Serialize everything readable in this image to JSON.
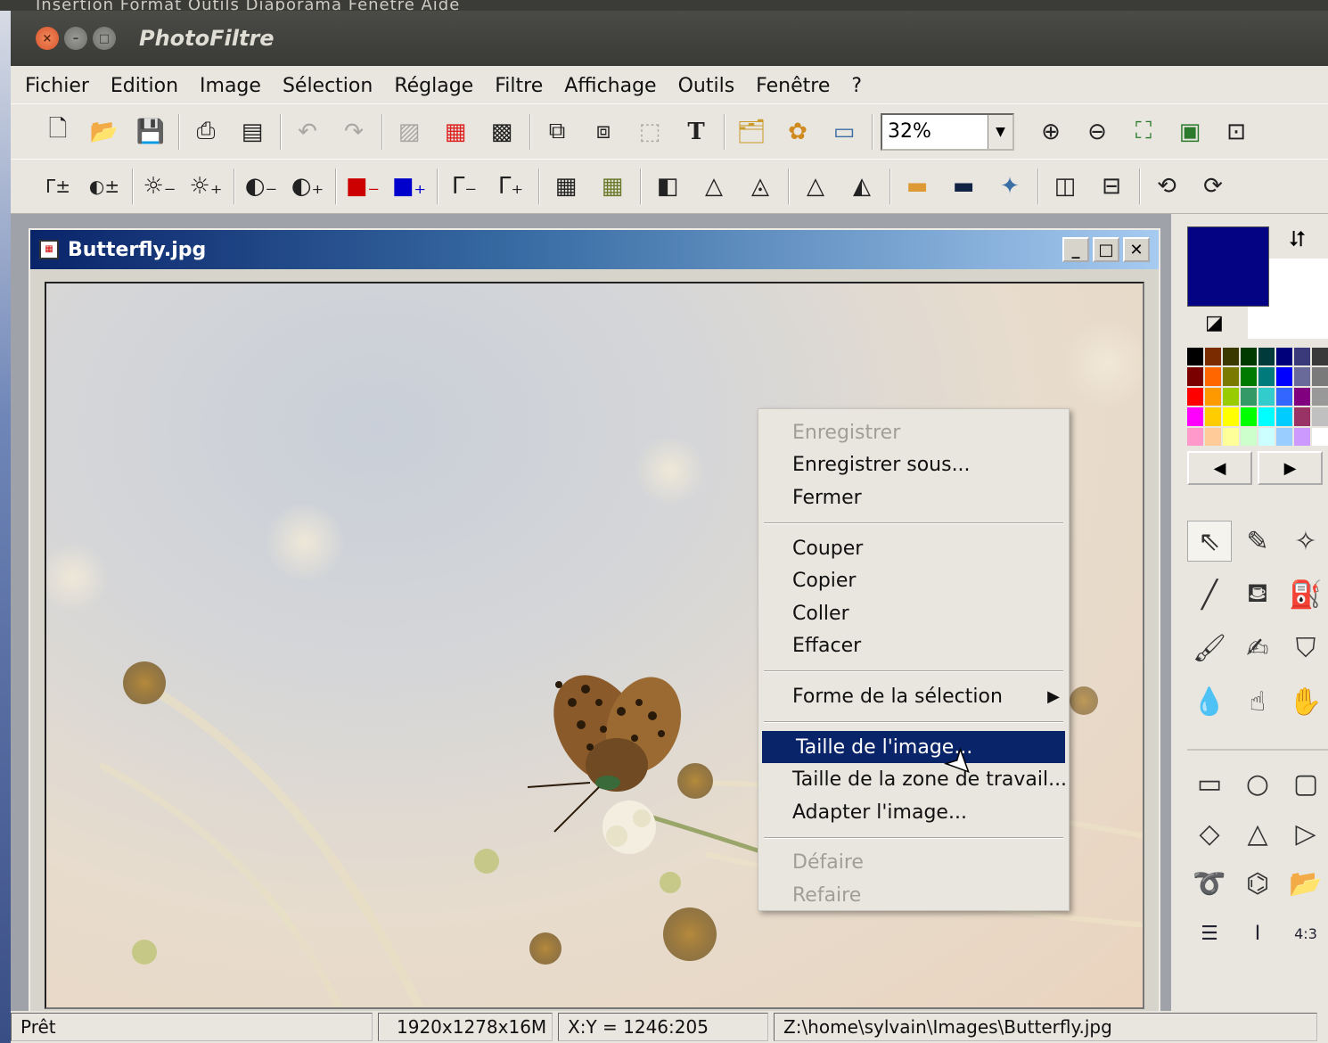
{
  "background_menu_text": "Insertion   Format   Outils   Diaporama   Fenêtre   Aide",
  "app": {
    "title": "PhotoFiltre"
  },
  "menubar": {
    "items": [
      "Fichier",
      "Edition",
      "Image",
      "Sélection",
      "Réglage",
      "Filtre",
      "Affichage",
      "Outils",
      "Fenêtre",
      "?"
    ]
  },
  "toolbar1": {
    "zoom_value": "32%"
  },
  "document": {
    "title": "Butterfly.jpg",
    "min_label": "_",
    "max_label": "□",
    "close_label": "✕"
  },
  "context_menu": {
    "items": [
      {
        "label": "Enregistrer",
        "disabled": true
      },
      {
        "label": "Enregistrer sous...",
        "disabled": false
      },
      {
        "label": "Fermer",
        "disabled": false
      },
      {
        "label": "Couper",
        "disabled": false
      },
      {
        "label": "Copier",
        "disabled": false
      },
      {
        "label": "Coller",
        "disabled": false
      },
      {
        "label": "Effacer",
        "disabled": false
      },
      {
        "label": "Forme de la sélection",
        "disabled": false,
        "submenu": true
      },
      {
        "label": "Taille de l'image...",
        "disabled": false,
        "highlighted": true
      },
      {
        "label": "Taille de la zone de travail...",
        "disabled": false
      },
      {
        "label": "Adapter l'image...",
        "disabled": false
      },
      {
        "label": "Défaire",
        "disabled": true
      },
      {
        "label": "Refaire",
        "disabled": true
      }
    ]
  },
  "colors": {
    "foreground": "#030384",
    "background": "#ffffff",
    "highlight": "#0a246a"
  },
  "palette": [
    "#000000",
    "#7a2c00",
    "#3a3a00",
    "#003a00",
    "#003a3a",
    "#00007a",
    "#3a3a7a",
    "#3a3a3a",
    "#7a0000",
    "#ff6600",
    "#7a7a00",
    "#007a00",
    "#007a7a",
    "#0000ff",
    "#6a6a9a",
    "#7a7a7a",
    "#ff0000",
    "#ff9900",
    "#99cc00",
    "#339966",
    "#33cccc",
    "#3366ff",
    "#800080",
    "#999999",
    "#ff00ff",
    "#ffcc00",
    "#ffff00",
    "#00ff00",
    "#00ffff",
    "#00ccff",
    "#993366",
    "#c0c0c0",
    "#ff99cc",
    "#ffcc99",
    "#ffff99",
    "#ccffcc",
    "#ccffff",
    "#99ccff",
    "#cc99ff",
    "#ffffff"
  ],
  "status": {
    "ready": "Prêt",
    "dimensions": "1920x1278x16M",
    "coords": "X:Y = 1246:205",
    "path": "Z:\\home\\sylvain\\Images\\Butterfly.jpg"
  }
}
